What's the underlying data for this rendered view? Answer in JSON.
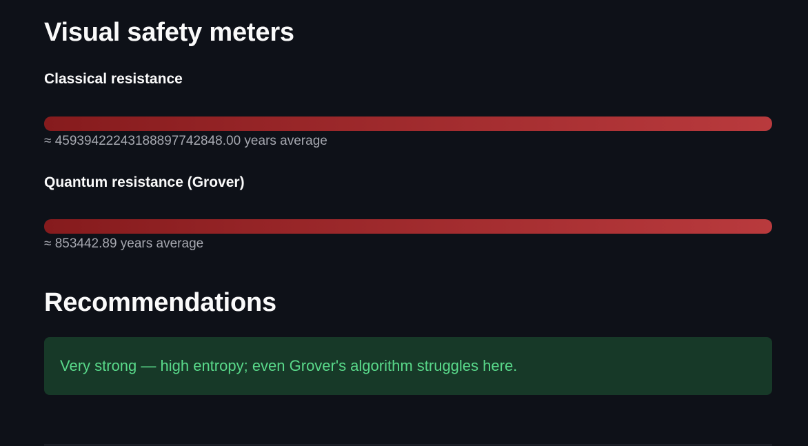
{
  "meters_section": {
    "title": "Visual safety meters",
    "meters": [
      {
        "label": "Classical resistance",
        "fill_percent": 100,
        "caption": "≈ 4593942224318889774284​8.00 years average"
      },
      {
        "label": "Quantum resistance (Grover)",
        "fill_percent": 100,
        "caption": "≈ 853442.89 years average"
      }
    ]
  },
  "recommendations": {
    "title": "Recommendations",
    "message": "Very strong — high entropy; even Grover's algorithm struggles here."
  },
  "colors": {
    "background": "#0e1118",
    "bar_start": "#861b1d",
    "bar_end": "#b93a3d",
    "success_bg": "#173928",
    "success_text": "#59d98a"
  }
}
